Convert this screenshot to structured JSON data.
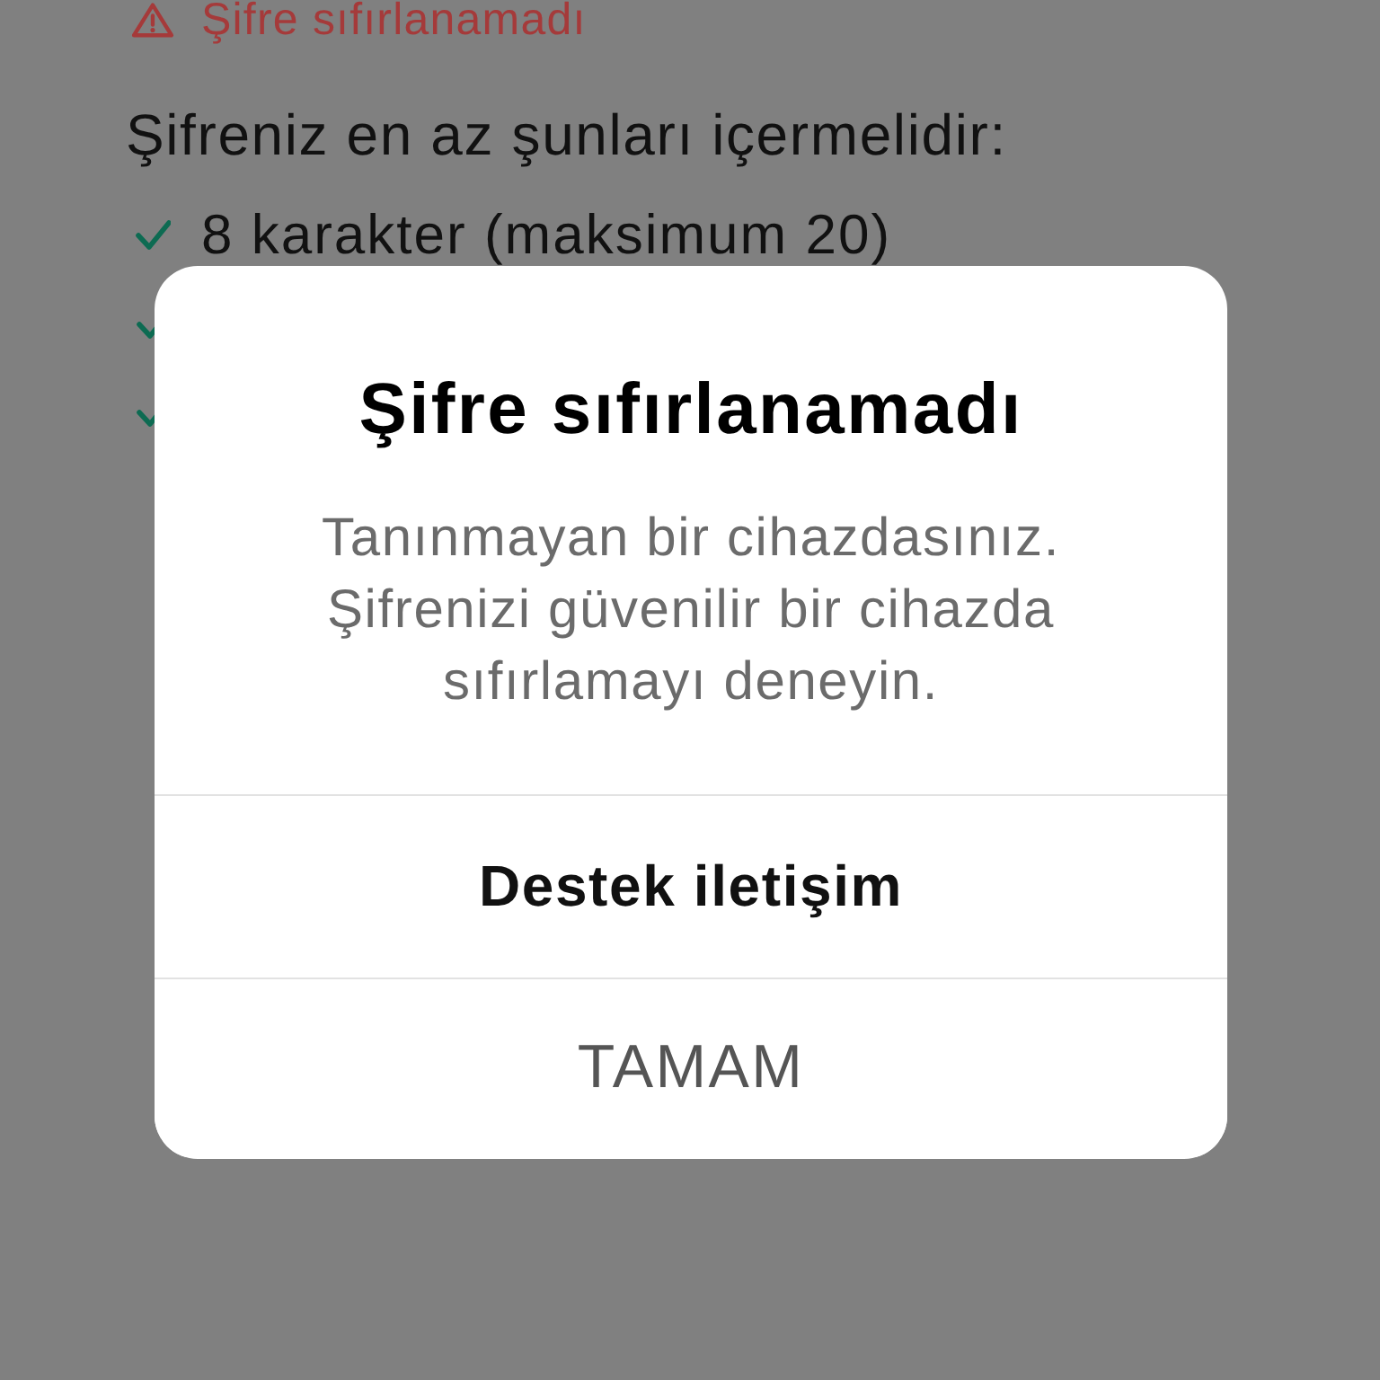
{
  "background_page": {
    "error_message": {
      "text": "Şifre sıfırlanamadı"
    },
    "requirements_heading": "Şifreniz en az şunları içermelidir:",
    "requirements": [
      {
        "text": "8 karakter (maksimum 20)",
        "met": true
      },
      {
        "met": true
      },
      {
        "met": true
      }
    ]
  },
  "dialog": {
    "title": "Şifre sıfırlanamadı",
    "message": "Tanınmayan bir cihazdasınız. Şifrenizi güvenilir bir cihazda sıfırlamayı deneyin.",
    "buttons": [
      {
        "label": "Destek iletişim",
        "kind": "primary"
      },
      {
        "label": "TAMAM",
        "kind": "secondary"
      }
    ]
  }
}
